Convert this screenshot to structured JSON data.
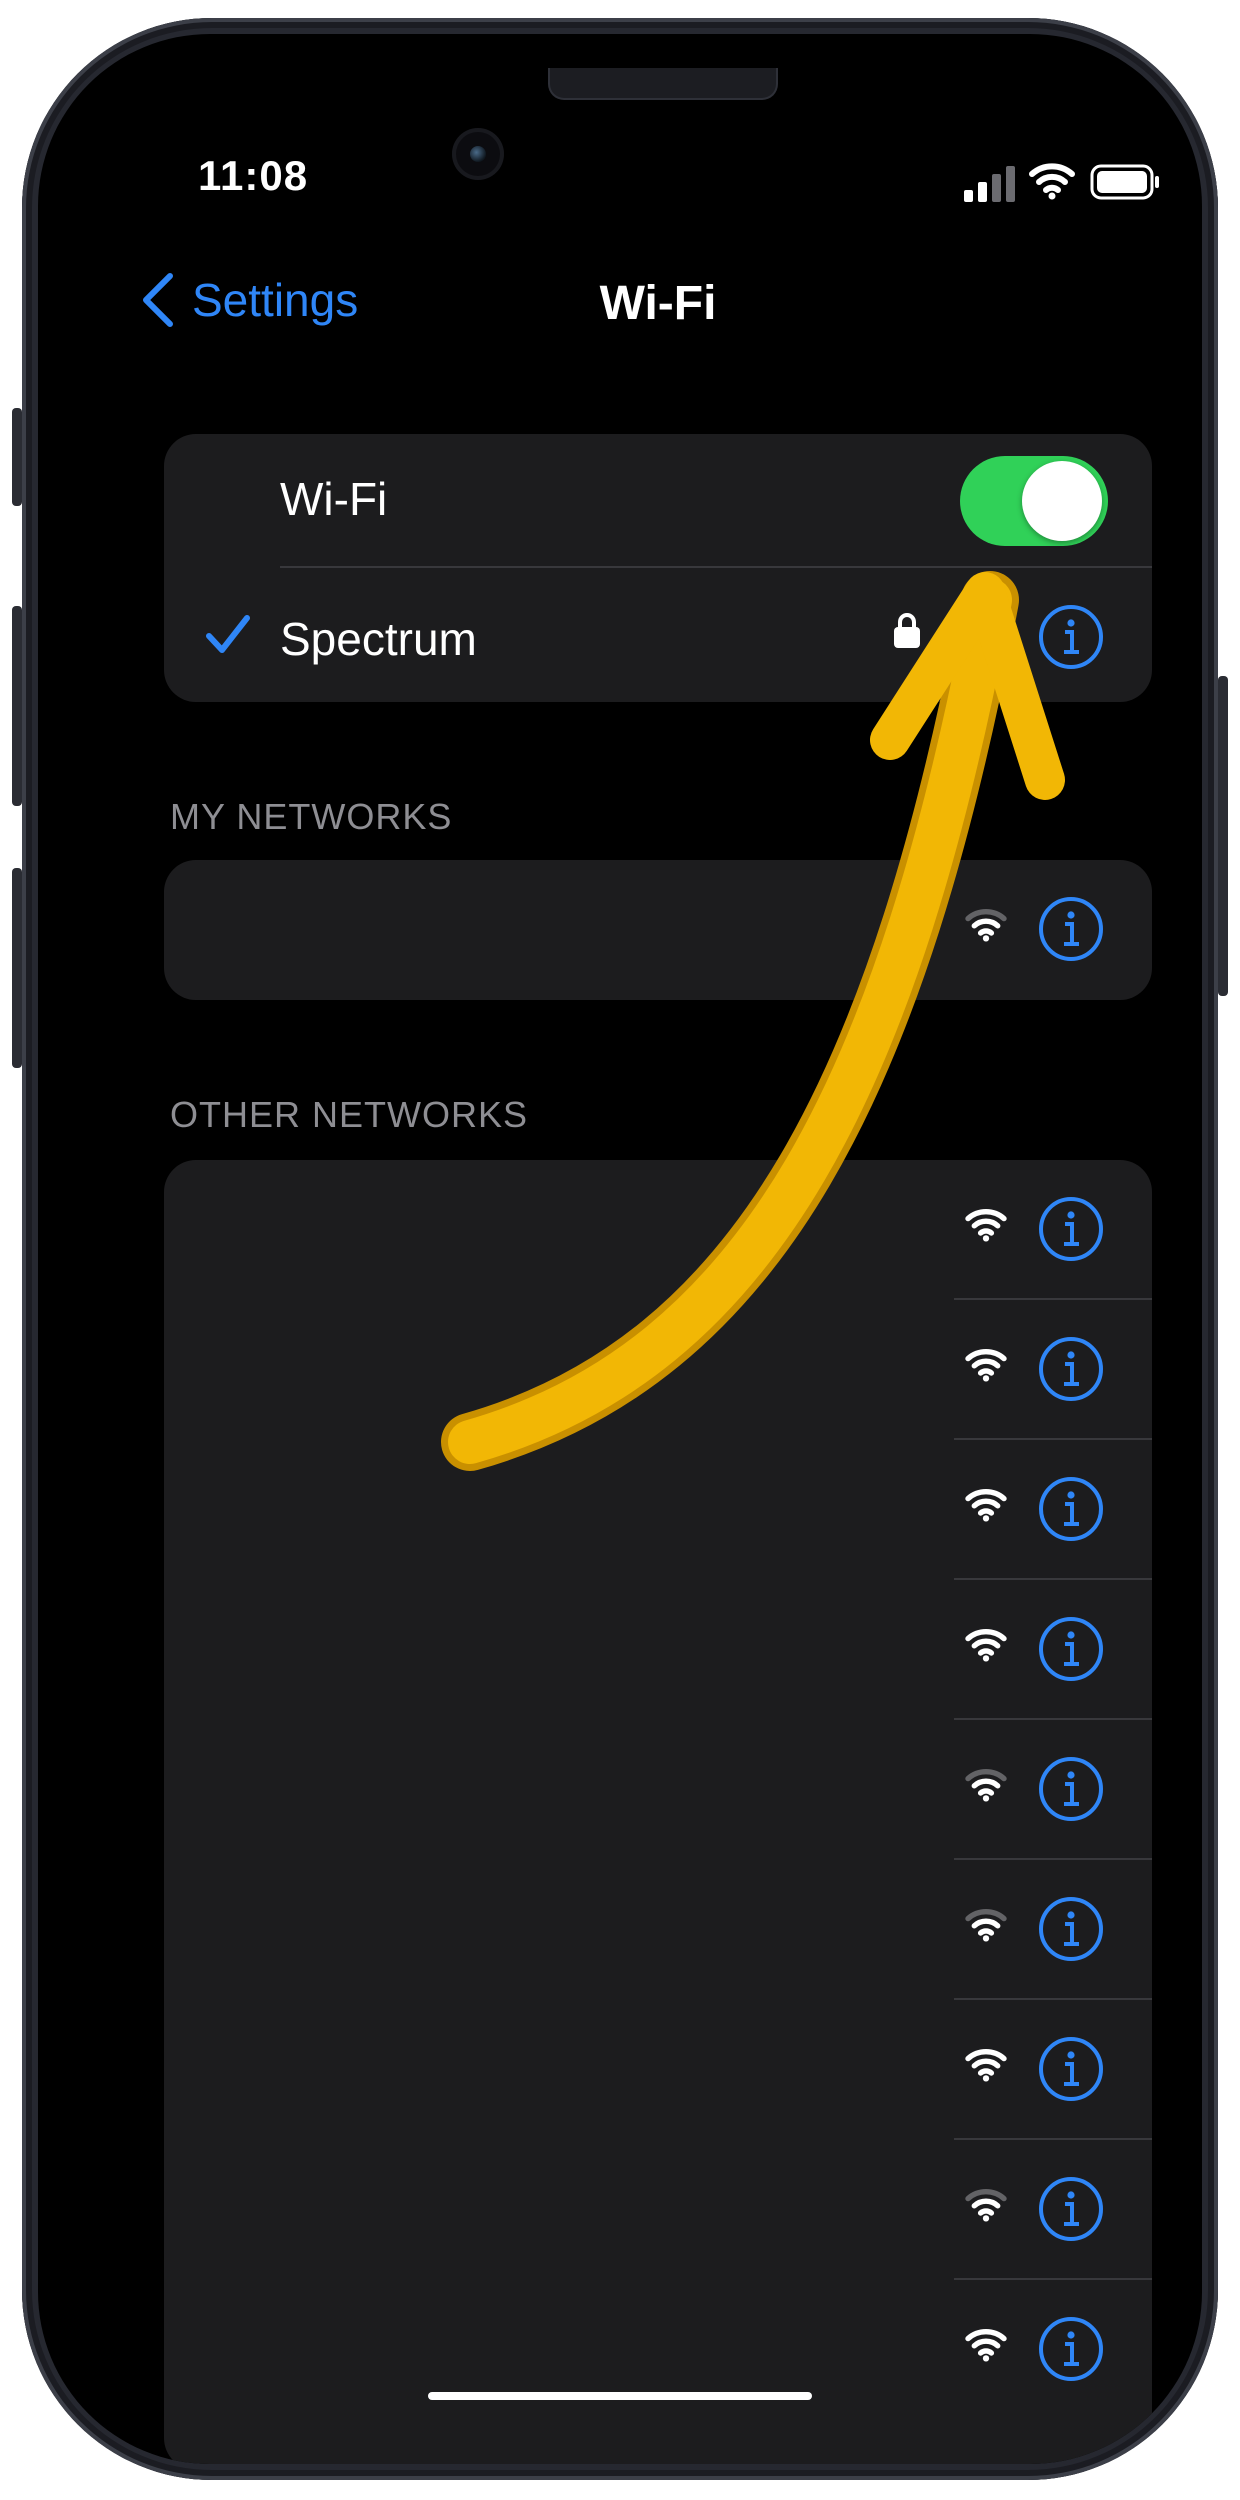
{
  "status_bar": {
    "time": "11:08",
    "icons": [
      "signal-bars-icon",
      "wifi-icon",
      "battery-icon"
    ]
  },
  "nav": {
    "back_label": "Settings",
    "title": "Wi-Fi"
  },
  "wifi_toggle": {
    "label": "Wi-Fi",
    "on": true,
    "on_color": "#30d158"
  },
  "connected_network": {
    "name": "Spectrum",
    "secured": true,
    "connected": true
  },
  "sections": {
    "my_networks": "MY NETWORKS",
    "other_networks": "OTHER NETWORKS"
  },
  "my_networks": [
    {
      "name": "",
      "secured": true,
      "signal": "weak"
    }
  ],
  "other_networks": [
    {
      "name": "",
      "signal": "strong"
    },
    {
      "name": "",
      "signal": "strong"
    },
    {
      "name": "",
      "signal": "strong"
    },
    {
      "name": "",
      "signal": "strong"
    },
    {
      "name": "",
      "signal": "weak"
    },
    {
      "name": "",
      "signal": "weak"
    },
    {
      "name": "",
      "signal": "strong"
    },
    {
      "name": "",
      "signal": "weak"
    },
    {
      "name": "",
      "signal": "strong"
    }
  ],
  "colors": {
    "accent": "#2f86f7",
    "background": "#000000",
    "group_background": "#1c1c1e",
    "annotation_arrow": "#f2b705"
  },
  "annotation": {
    "type": "arrow",
    "points_to": "wifi-toggle"
  }
}
